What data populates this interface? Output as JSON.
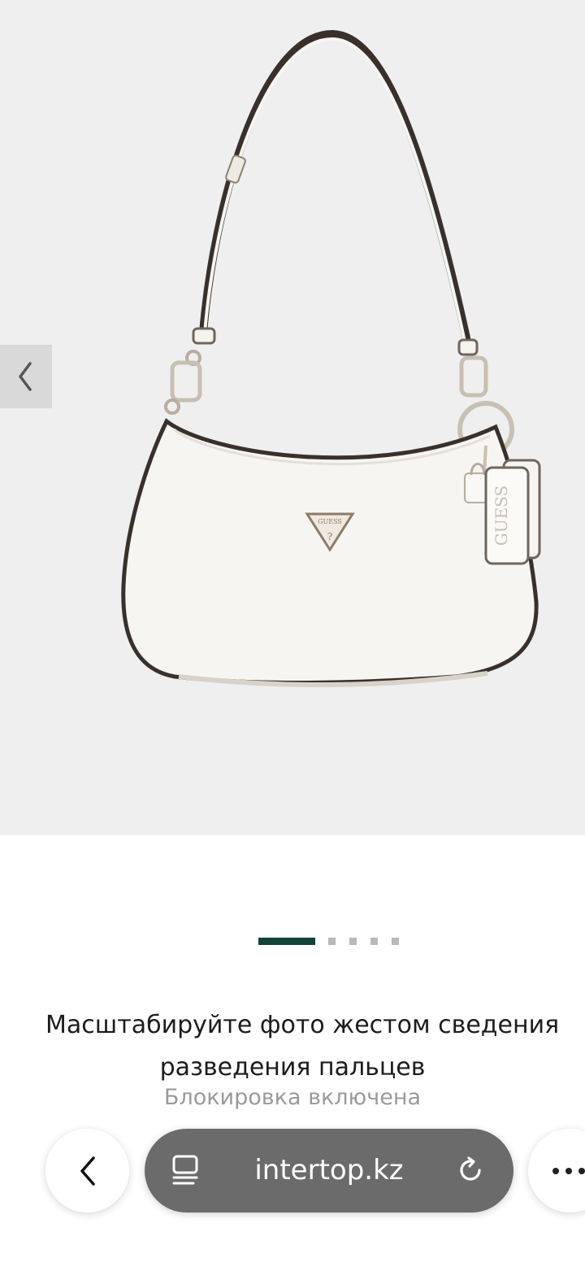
{
  "gallery": {
    "slide_count": 5,
    "active_slide": 1,
    "bag_logo_text": "GUESS",
    "tag_text": "GUESS"
  },
  "zoom_hint": {
    "line1": "Масштабируйте фото жестом сведения",
    "line2": "разведения пальцев",
    "status": "Блокировка включена"
  },
  "browser": {
    "url": "intertop.kz"
  },
  "icons": {
    "prev": "chevron-left-icon",
    "back": "chevron-left-icon",
    "tabs": "tabs-icon",
    "reload": "reload-icon",
    "more": "more-horizontal-icon"
  },
  "colors": {
    "gallery_bg": "#efefef",
    "active_dot": "#12433a",
    "inactive_dot": "#b9b9b9",
    "url_pill": "#6b6b6b",
    "status_text": "#9a9a9a"
  }
}
